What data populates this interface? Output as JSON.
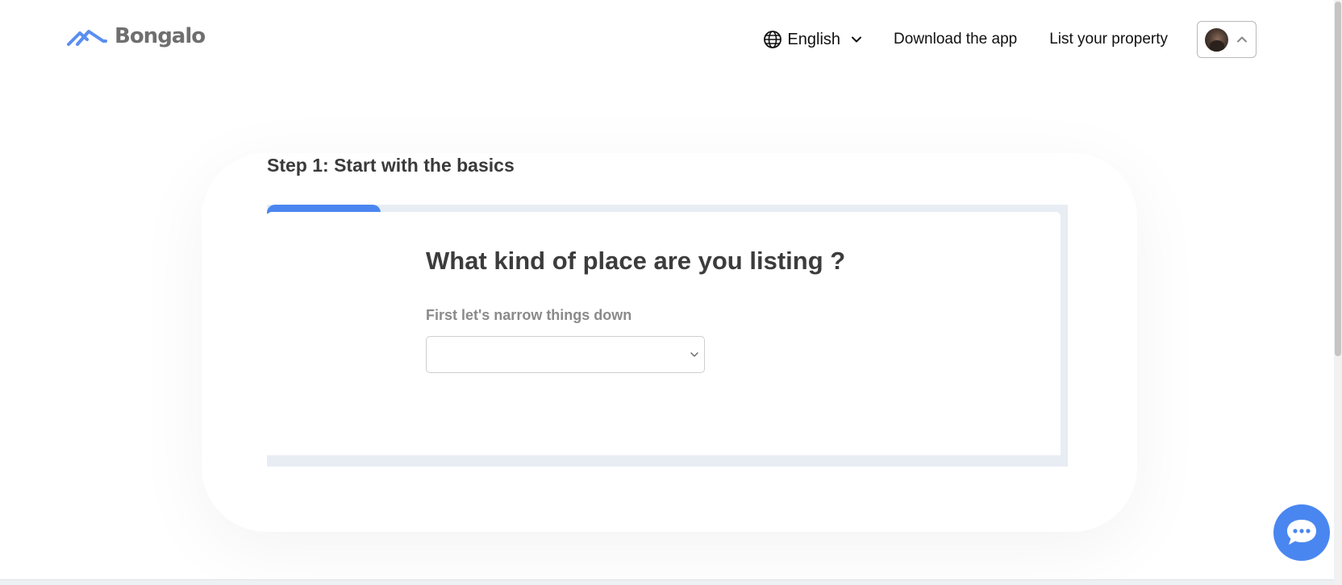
{
  "brand": {
    "name": "Bongalo",
    "logo_icon": "house-roof-icon",
    "color": "#4a86f0"
  },
  "nav": {
    "language_label": "English",
    "language_icon": "globe-icon",
    "download_label": "Download the app",
    "list_property_label": "List your property",
    "profile_icon": "avatar"
  },
  "main": {
    "step_title": "Step 1: Start with the basics",
    "progress_fraction": 0.14,
    "question": "What kind of place are you listing ?",
    "hint": "First let's narrow things down",
    "select": {
      "selected_value": "",
      "icon": "chevron-down-icon"
    }
  },
  "chat": {
    "icon": "chat-bubble-icon",
    "color": "#4a86f0"
  }
}
